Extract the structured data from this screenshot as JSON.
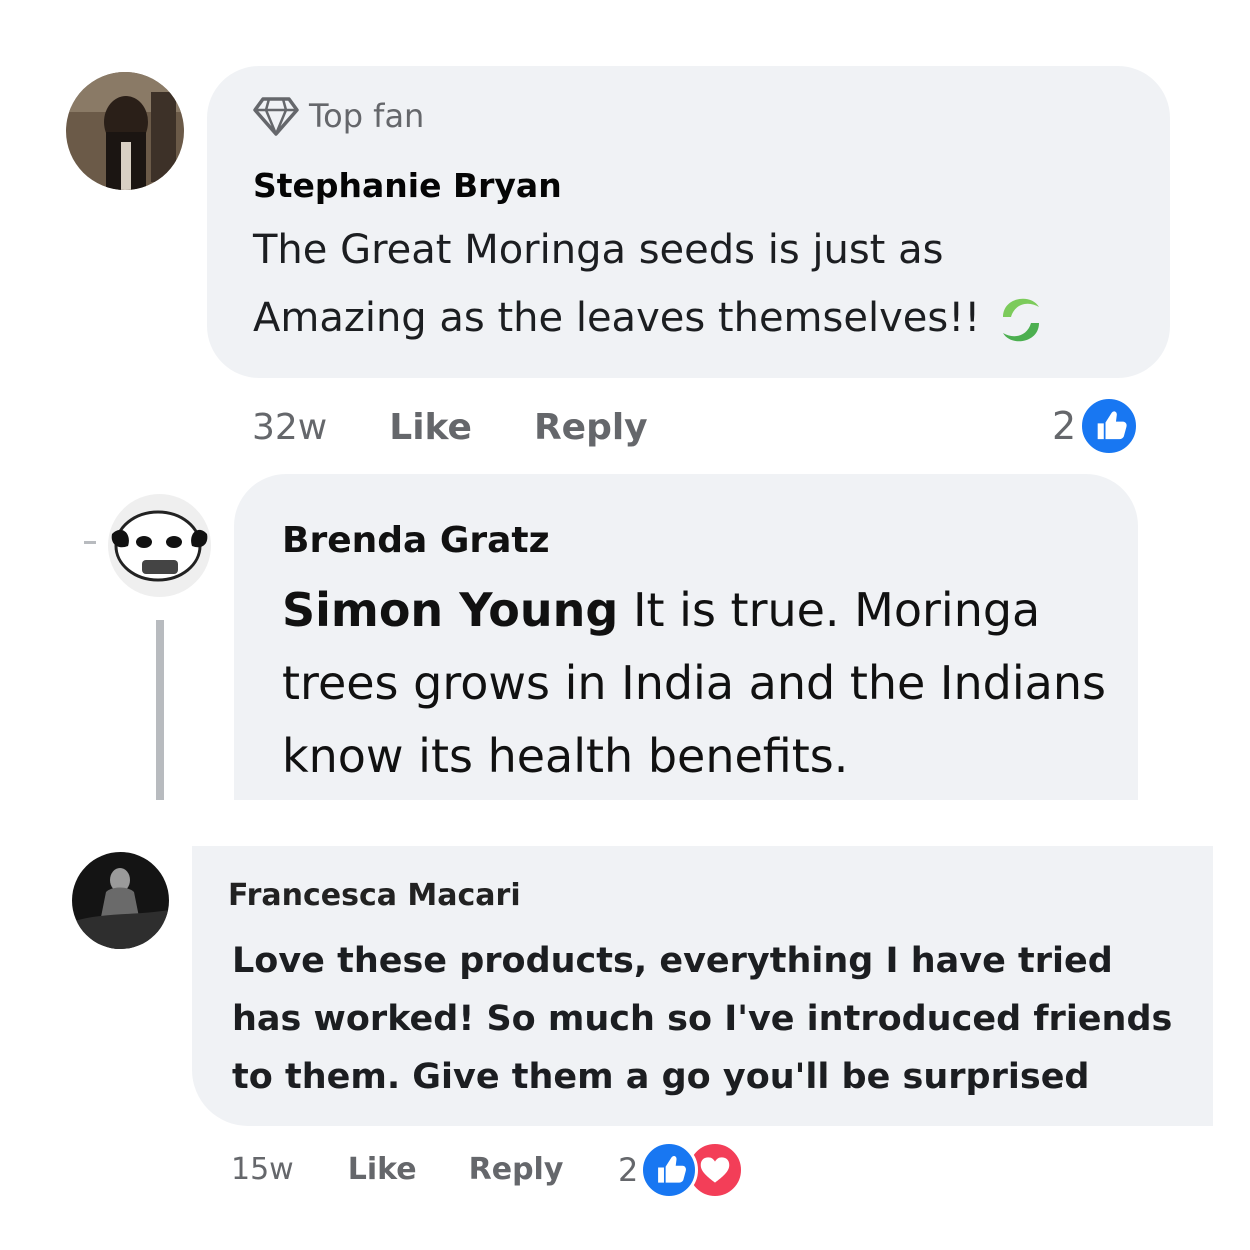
{
  "comments": [
    {
      "badge": "Top fan",
      "author": "Stephanie Bryan",
      "text": "The Great Moringa seeds is just as Amazing as the leaves themselves!!",
      "time": "32w",
      "like_label": "Like",
      "reply_label": "Reply",
      "reaction_count": "2",
      "reactions": [
        "like-icon"
      ]
    },
    {
      "author": "Brenda Gratz",
      "mention": "Simon Young",
      "text": "It is true. Moringa trees grows in India and the Indians know its health benefits."
    },
    {
      "author": "Francesca Macari",
      "text": "Love these products, everything I have tried has worked! So much so I've introduced friends to them. Give them a go you'll be surprised",
      "time": "15w",
      "like_label": "Like",
      "reply_label": "Reply",
      "reaction_count": "2",
      "reactions": [
        "like-icon",
        "love-icon"
      ]
    }
  ],
  "colors": {
    "bubble": "#f0f2f5",
    "secondary_text": "#65676b",
    "like_blue": "#1877f2",
    "love_red": "#f33e58",
    "leaf_green": "#4caf50"
  }
}
